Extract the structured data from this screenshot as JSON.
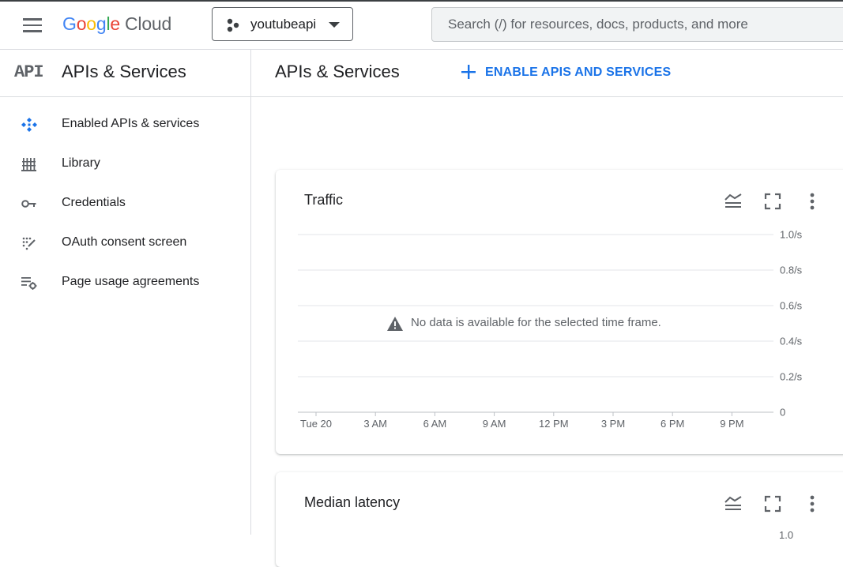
{
  "topbar": {
    "logo": {
      "google_letters": [
        {
          "ch": "G",
          "color": "#4285F4"
        },
        {
          "ch": "o",
          "color": "#EA4335"
        },
        {
          "ch": "o",
          "color": "#FBBC05"
        },
        {
          "ch": "g",
          "color": "#4285F4"
        },
        {
          "ch": "l",
          "color": "#34A853"
        },
        {
          "ch": "e",
          "color": "#EA4335"
        }
      ],
      "cloud": "Cloud"
    },
    "project_name": "youtubeapi",
    "search_placeholder": "Search (/) for resources, docs, products, and more"
  },
  "sidebar": {
    "api_mark": "API",
    "title": "APIs & Services",
    "items": [
      {
        "label": "Enabled APIs & services",
        "icon": "enabled-apis-icon",
        "active": true
      },
      {
        "label": "Library",
        "icon": "library-icon",
        "active": false
      },
      {
        "label": "Credentials",
        "icon": "key-icon",
        "active": false
      },
      {
        "label": "OAuth consent screen",
        "icon": "oauth-icon",
        "active": false
      },
      {
        "label": "Page usage agreements",
        "icon": "settings-list-icon",
        "active": false
      }
    ]
  },
  "main": {
    "title": "APIs & Services",
    "enable_button": "ENABLE APIS AND SERVICES"
  },
  "cards": [
    {
      "title": "Traffic",
      "no_data": "No data is available for the selected time frame.",
      "chart_data": {
        "type": "line",
        "title": "Traffic",
        "x_ticks": [
          "Tue 20",
          "3 AM",
          "6 AM",
          "9 AM",
          "12 PM",
          "3 PM",
          "6 PM",
          "9 PM"
        ],
        "y_ticks": [
          "0",
          "0.2/s",
          "0.4/s",
          "0.6/s",
          "0.8/s",
          "1.0/s"
        ],
        "ylim": [
          0,
          1.0
        ],
        "series": [],
        "grid": true
      }
    },
    {
      "title": "Median latency",
      "partial_tick": "1.0"
    }
  ],
  "colors": {
    "accent": "#1a73e8",
    "active_bg": "#e8f0fe",
    "active_text": "#1a56c8",
    "icon": "#5f6368"
  }
}
